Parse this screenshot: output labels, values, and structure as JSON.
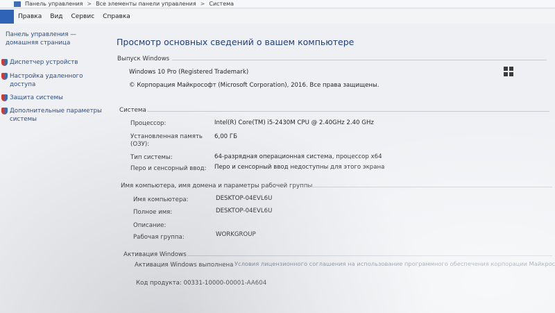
{
  "breadcrumb": {
    "items": [
      "Панель управления",
      "Все элементы панели управления",
      "Система"
    ],
    "separator": ">"
  },
  "menu": {
    "items": [
      "Правка",
      "Вид",
      "Сервис",
      "Справка"
    ]
  },
  "sidebar": {
    "home_line1": "Панель управления —",
    "home_line2": "домашняя страница",
    "items": [
      {
        "label_line1": "Диспетчер устройств",
        "label_line2": ""
      },
      {
        "label_line1": "Настройка удаленного",
        "label_line2": "доступа"
      },
      {
        "label_line1": "Защита системы",
        "label_line2": ""
      },
      {
        "label_line1": "Дополнительные параметры",
        "label_line2": "системы"
      }
    ]
  },
  "main": {
    "title": "Просмотр основных сведений о вашем компьютере",
    "edition": {
      "section": "Выпуск Windows",
      "name": "Windows 10 Pro (Registered Trademark)",
      "copyright": "© Корпорация Майкрософт (Microsoft Corporation), 2016. Все права защищены."
    },
    "system": {
      "section": "Система",
      "processor_label": "Процессор:",
      "processor_value": "Intel(R) Core(TM) i5-2430M CPU @ 2.40GHz   2.40 GHz",
      "ram_label_line1": "Установленная память",
      "ram_label_line2": "(ОЗУ):",
      "ram_value": "6,00 ГБ",
      "type_label": "Тип системы:",
      "type_value": "64-разрядная операционная система, процессор x64",
      "pen_label": "Перо и сенсорный ввод:",
      "pen_value": "Перо и сенсорный ввод недоступны для этого экрана"
    },
    "computer": {
      "section": "Имя компьютера, имя домена и параметры рабочей группы",
      "name_label": "Имя компьютера:",
      "name_value": "DESKTOP-04EVL6U",
      "full_label": "Полное имя:",
      "full_value": "DESKTOP-04EVL6U",
      "desc_label": "Описание:",
      "desc_value": "",
      "group_label": "Рабочая группа:",
      "group_value": "WORKGROUP"
    },
    "activation": {
      "section": "Активация Windows",
      "status": "Активация Windows выполнена",
      "license_link": "Условия лицензионного соглашения на использование программного обеспечения корпорации Майкрософт",
      "product_id": "Код продукта:  00331-10000-00001-AA604"
    }
  }
}
